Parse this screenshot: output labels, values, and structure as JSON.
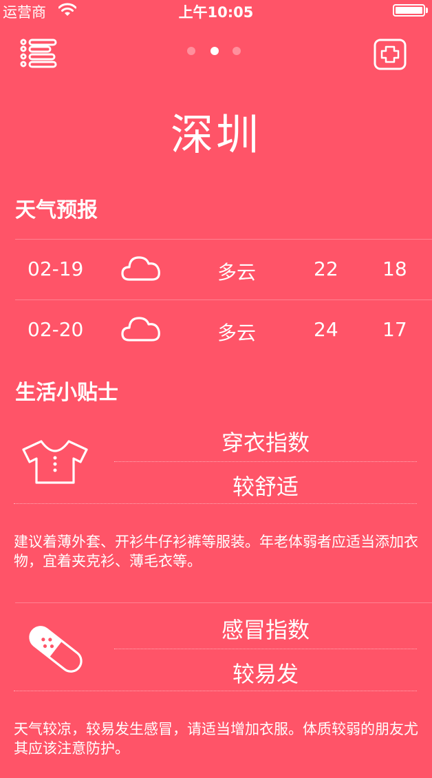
{
  "status_bar": {
    "carrier": "运营商",
    "time": "上午10:05",
    "wifi_icon": "wifi-icon",
    "battery_icon": "battery-icon"
  },
  "nav": {
    "menu_icon": "list-menu-icon",
    "add_icon": "add-square-icon",
    "page_count": 3,
    "active_page": 1
  },
  "city": "深圳",
  "forecast": {
    "title": "天气预报",
    "rows": [
      {
        "date": "02-19",
        "icon": "cloud-icon",
        "condition": "多云",
        "high": "22",
        "low": "18"
      },
      {
        "date": "02-20",
        "icon": "cloud-icon",
        "condition": "多云",
        "high": "24",
        "low": "17"
      }
    ]
  },
  "tips": {
    "title": "生活小贴士",
    "items": [
      {
        "icon": "tshirt-icon",
        "name": "穿衣指数",
        "level": "较舒适",
        "description": "建议着薄外套、开衫牛仔衫裤等服装。年老体弱者应适当添加衣物，宜着夹克衫、薄毛衣等。"
      },
      {
        "icon": "bandage-icon",
        "name": "感冒指数",
        "level": "较易发",
        "description": "天气较凉，较易发生感冒，请适当增加衣服。体质较弱的朋友尤其应该注意防护。"
      }
    ]
  },
  "colors": {
    "background": "#FF5468",
    "foreground": "#FFFFFF"
  }
}
